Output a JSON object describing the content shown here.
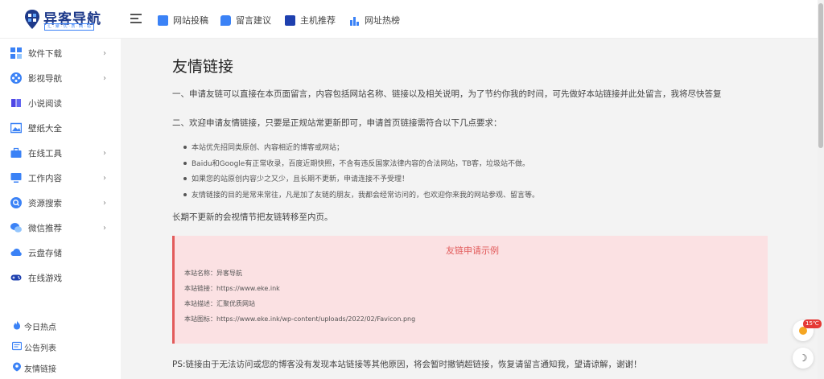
{
  "brand": {
    "title": "异客导航",
    "subtitle": "汇 · 聚 · 优 · 质 · 网 · 站",
    "accent": "#1e3a8a"
  },
  "header": {
    "nav": [
      {
        "label": "网站投稿",
        "icon": "edit-icon",
        "color": "#3b82f6"
      },
      {
        "label": "留言建议",
        "icon": "chat-icon",
        "color": "#3b82f6"
      },
      {
        "label": "主机推荐",
        "icon": "server-icon",
        "color": "#1e40af"
      },
      {
        "label": "网址热榜",
        "icon": "bar-chart-icon",
        "color": "#3b82f6"
      }
    ]
  },
  "sidebar": {
    "items": [
      {
        "label": "软件下载",
        "icon": "grid-icon",
        "color": "#3b82f6",
        "chevron": "›"
      },
      {
        "label": "影视导航",
        "icon": "film-reel-icon",
        "color": "#3b82f6",
        "chevron": "›"
      },
      {
        "label": "小说阅读",
        "icon": "book-icon",
        "color": "#4f46e5",
        "chevron": ""
      },
      {
        "label": "壁纸大全",
        "icon": "image-icon",
        "color": "#3b82f6",
        "chevron": ""
      },
      {
        "label": "在线工具",
        "icon": "toolbox-icon",
        "color": "#3b82f6",
        "chevron": "›"
      },
      {
        "label": "工作内容",
        "icon": "monitor-icon",
        "color": "#3b82f6",
        "chevron": "›"
      },
      {
        "label": "资源搜索",
        "icon": "search-icon",
        "color": "#3b82f6",
        "chevron": "›"
      },
      {
        "label": "微信推荐",
        "icon": "wechat-icon",
        "color": "#3b82f6",
        "chevron": "›"
      },
      {
        "label": "云盘存储",
        "icon": "cloud-icon",
        "color": "#3b82f6",
        "chevron": ""
      },
      {
        "label": "在线游戏",
        "icon": "gamepad-icon",
        "color": "#3b82f6",
        "chevron": ""
      }
    ],
    "footer": [
      {
        "label": "今日热点",
        "icon": "fire-icon",
        "color": "#3b82f6"
      },
      {
        "label": "公告列表",
        "icon": "announcement-icon",
        "color": "#3b82f6"
      },
      {
        "label": "友情链接",
        "icon": "link-icon",
        "color": "#3b82f6"
      }
    ]
  },
  "main": {
    "title": "友情链接",
    "intro1": "一、申请友链可以直接在本页面留言，内容包括网站名称、链接以及相关说明，为了节约你我的时间，可先做好本站链接并此处留言，我将尽快答复",
    "intro2": "二、欢迎申请友情链接，只要是正规站常更新即可，申请首页链接需符合以下几点要求：",
    "bullets": [
      "本站优先招同类原创、内容相近的博客或网站；",
      "Baidu和Google有正常收录，百度近期快照，不含有违反国家法律内容的合法网站，TB客，垃圾站不做。",
      "如果您的站原创内容少之又少，且长期不更新，申请连接不予受理！",
      "友情链接的目的是常来常往，凡是加了友链的朋友，我都会经常访问的，也欢迎你来我的网站参观、留言等。"
    ],
    "note": "长期不更新的会视情节把友链转移至内页。",
    "example": {
      "title": "友链申请示例",
      "lines": [
        "本站名称：异客导航",
        "本站链接：https://www.eke.ink",
        "本站描述：汇聚优质网站",
        "本站图标：https://www.eke.ink/wp-content/uploads/2022/02/Favicon.png"
      ]
    },
    "ps": "PS:链接由于无法访问或您的博客没有发现本站链接等其他原因，将会暂时撤销超链接，恢复请留言通知我，望请谅解，谢谢！"
  },
  "widgets": {
    "temperature": "15℃",
    "darkmode_glyph": "☽"
  }
}
